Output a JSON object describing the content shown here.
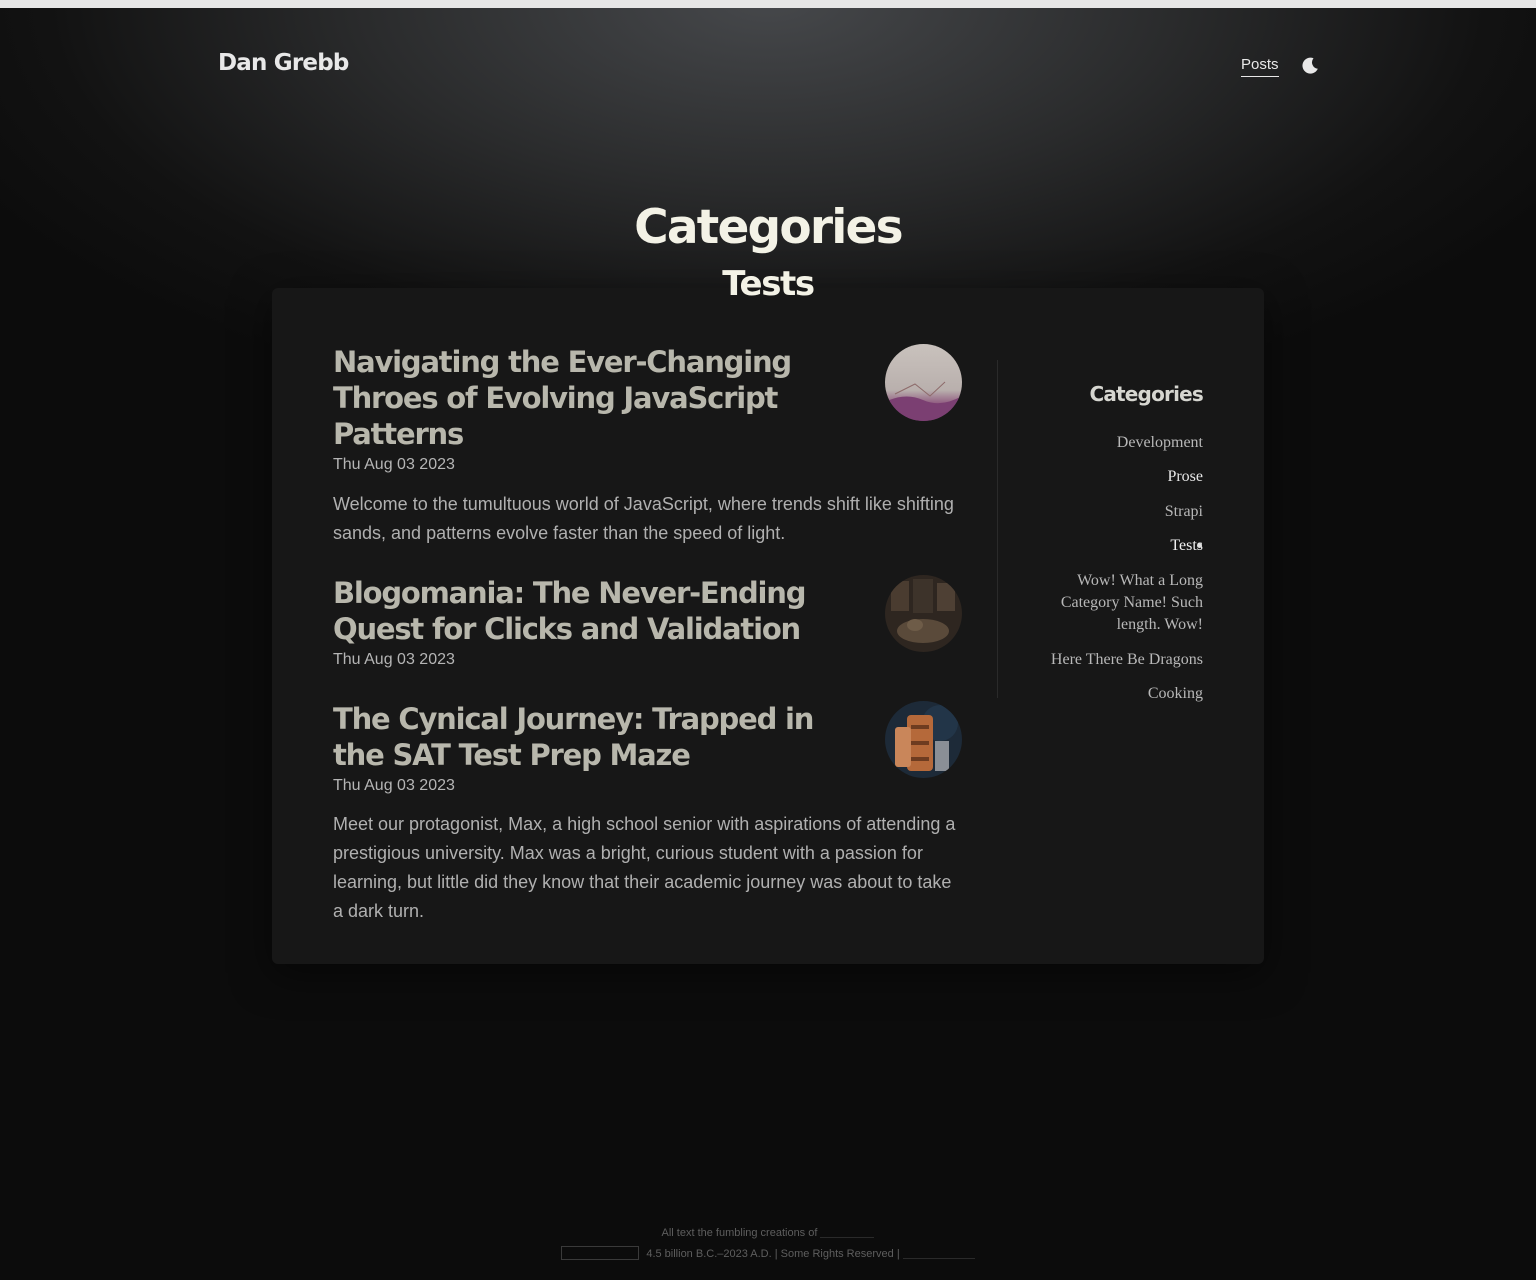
{
  "header": {
    "site_title": "Dan Grebb",
    "nav_posts": "Posts",
    "theme_toggle_icon": "moon-icon"
  },
  "page": {
    "heading": "Categories",
    "subheading": "Tests"
  },
  "posts": [
    {
      "title": "Navigating the Ever-Changing Throes of Evolving JavaScript Patterns",
      "date": "Thu Aug 03 2023",
      "excerpt": "Welcome to the tumultuous world of JavaScript, where trends shift like shifting sands, and patterns evolve faster than the speed of light."
    },
    {
      "title": "Blogomania: The Never-Ending Quest for Clicks and Validation",
      "date": "Thu Aug 03 2023",
      "excerpt": ""
    },
    {
      "title": "The Cynical Journey: Trapped in the SAT Test Prep Maze",
      "date": "Thu Aug 03 2023",
      "excerpt": "Meet our protagonist, Max, a high school senior with aspirations of attending a prestigious university. Max was a bright, curious student with a passion for learning, but little did they know that their academic journey was about to take a dark turn."
    }
  ],
  "sidebar": {
    "heading": "Categories",
    "items": [
      {
        "label": "Development"
      },
      {
        "label": "Prose"
      },
      {
        "label": "Strapi"
      },
      {
        "label": "Tests",
        "active": true
      },
      {
        "label": "Wow! What a Long Category Name! Such length. Wow!"
      },
      {
        "label": "Here There Be Dragons"
      },
      {
        "label": "Cooking"
      }
    ]
  },
  "footer": {
    "line1_text": "All text the fumbling creations of",
    "line2_text": "4.5 billion B.C.–2023 A.D. | Some Rights Reserved |"
  },
  "colors": {
    "background": "#121212",
    "panel": "#171717",
    "heading": "#f3f2e6",
    "post_title": "#b8b7ac"
  }
}
